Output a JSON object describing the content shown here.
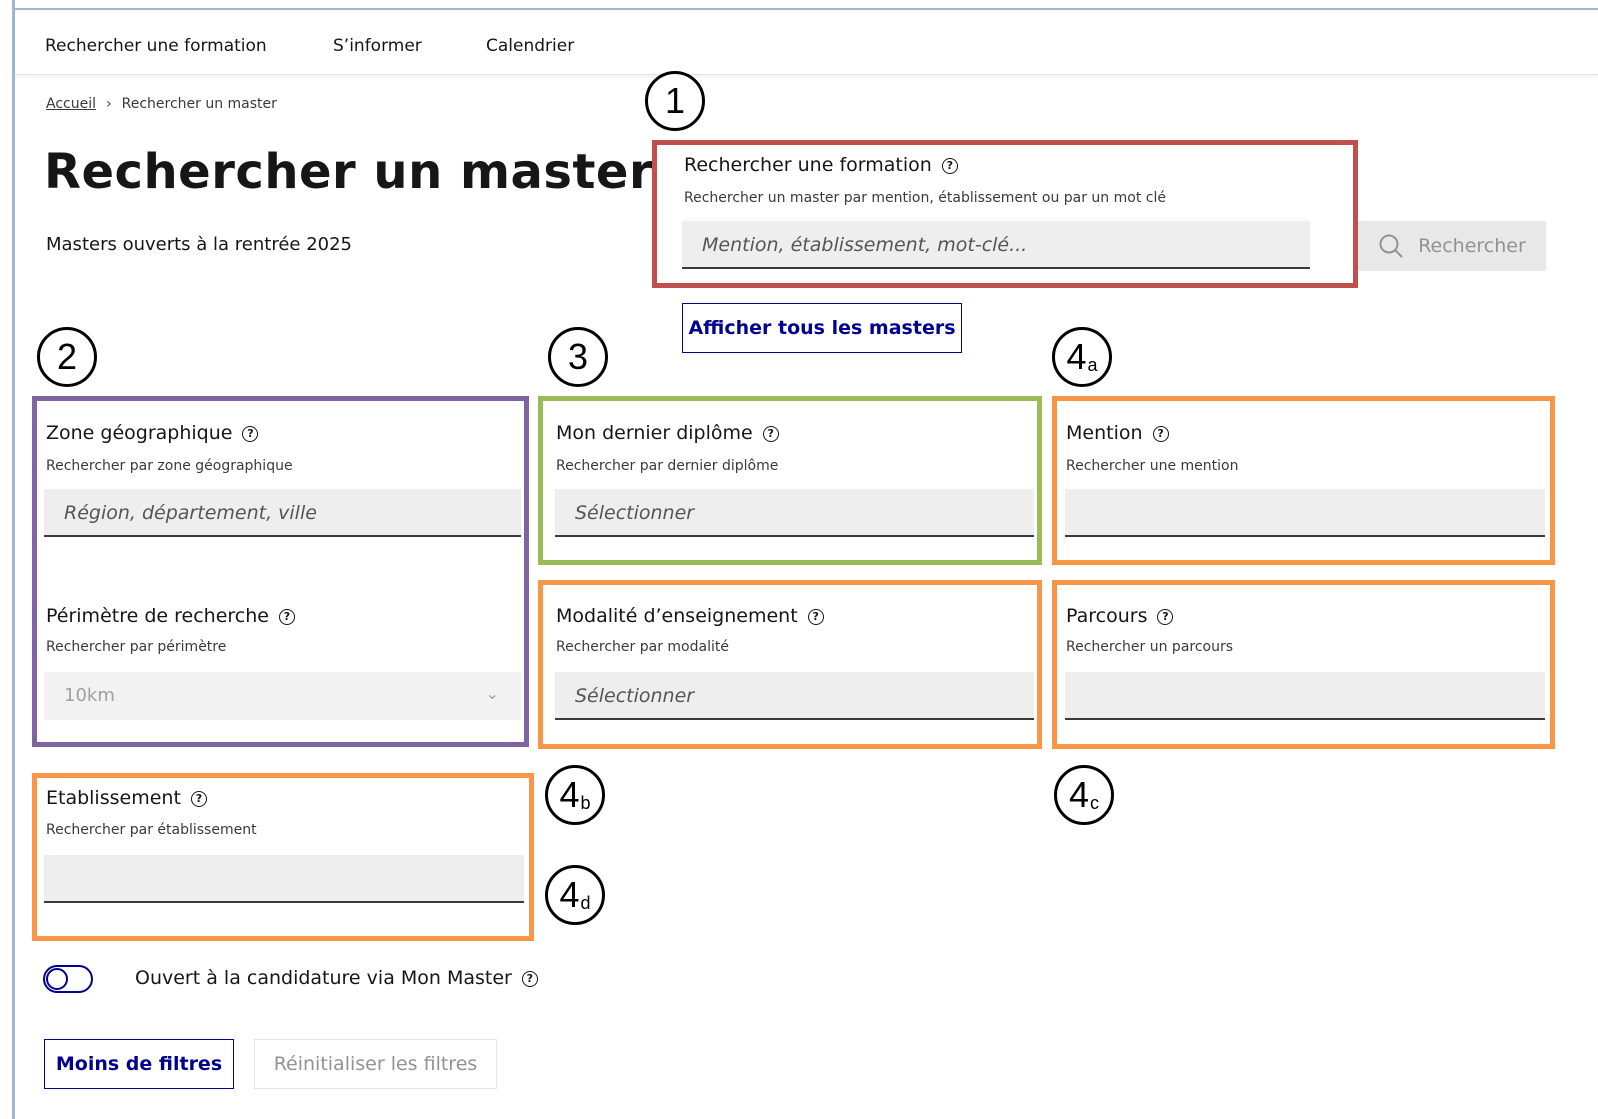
{
  "nav": {
    "items": [
      {
        "label": "Rechercher une formation"
      },
      {
        "label": "S’informer"
      },
      {
        "label": "Calendrier"
      }
    ]
  },
  "breadcrumb": {
    "home": "Accueil",
    "separator": "›",
    "current": "Rechercher un master"
  },
  "page": {
    "title": "Rechercher un master",
    "subtitle": "Masters ouverts à la rentrée 2025"
  },
  "search": {
    "label": "Rechercher une formation",
    "hint": "Rechercher un master par mention, établissement ou par un mot clé",
    "placeholder": "Mention, établissement, mot-clé...",
    "button_label": "Rechercher"
  },
  "show_all_label": "Afficher tous les masters",
  "filters": {
    "zone": {
      "label": "Zone géographique",
      "hint": "Rechercher par zone géographique",
      "placeholder": "Région, département, ville"
    },
    "perimetre": {
      "label": "Périmètre de recherche",
      "hint": "Rechercher par périmètre",
      "value": "10km"
    },
    "diplome": {
      "label": "Mon dernier diplôme",
      "hint": "Rechercher par dernier diplôme",
      "placeholder": "Sélectionner"
    },
    "mention": {
      "label": "Mention",
      "hint": "Rechercher une mention",
      "value": ""
    },
    "modalite": {
      "label": "Modalité d’enseignement",
      "hint": "Rechercher par modalité",
      "placeholder": "Sélectionner"
    },
    "parcours": {
      "label": "Parcours",
      "hint": "Rechercher un parcours",
      "value": ""
    },
    "etablissement": {
      "label": "Etablissement",
      "hint": "Rechercher par établissement",
      "value": ""
    }
  },
  "toggle": {
    "label": "Ouvert à la candidature via Mon Master",
    "checked": false
  },
  "buttons": {
    "less_filters": "Moins de filtres",
    "reset": "Réinitialiser les filtres"
  },
  "markers": {
    "m1": {
      "num": "1",
      "sub": ""
    },
    "m2": {
      "num": "2",
      "sub": ""
    },
    "m3": {
      "num": "3",
      "sub": ""
    },
    "m4a": {
      "num": "4",
      "sub": "a"
    },
    "m4b": {
      "num": "4",
      "sub": "b"
    },
    "m4c": {
      "num": "4",
      "sub": "c"
    },
    "m4d": {
      "num": "4",
      "sub": "d"
    }
  },
  "icons": {
    "help": "question-circle-icon",
    "search": "magnifier-icon",
    "select": "chevron-down-icon"
  },
  "colors": {
    "brand_blue": "#000091",
    "annotation_red": "#c0504d",
    "annotation_purple": "#8064a2",
    "annotation_green": "#9bbb59",
    "annotation_orange": "#f79646"
  }
}
